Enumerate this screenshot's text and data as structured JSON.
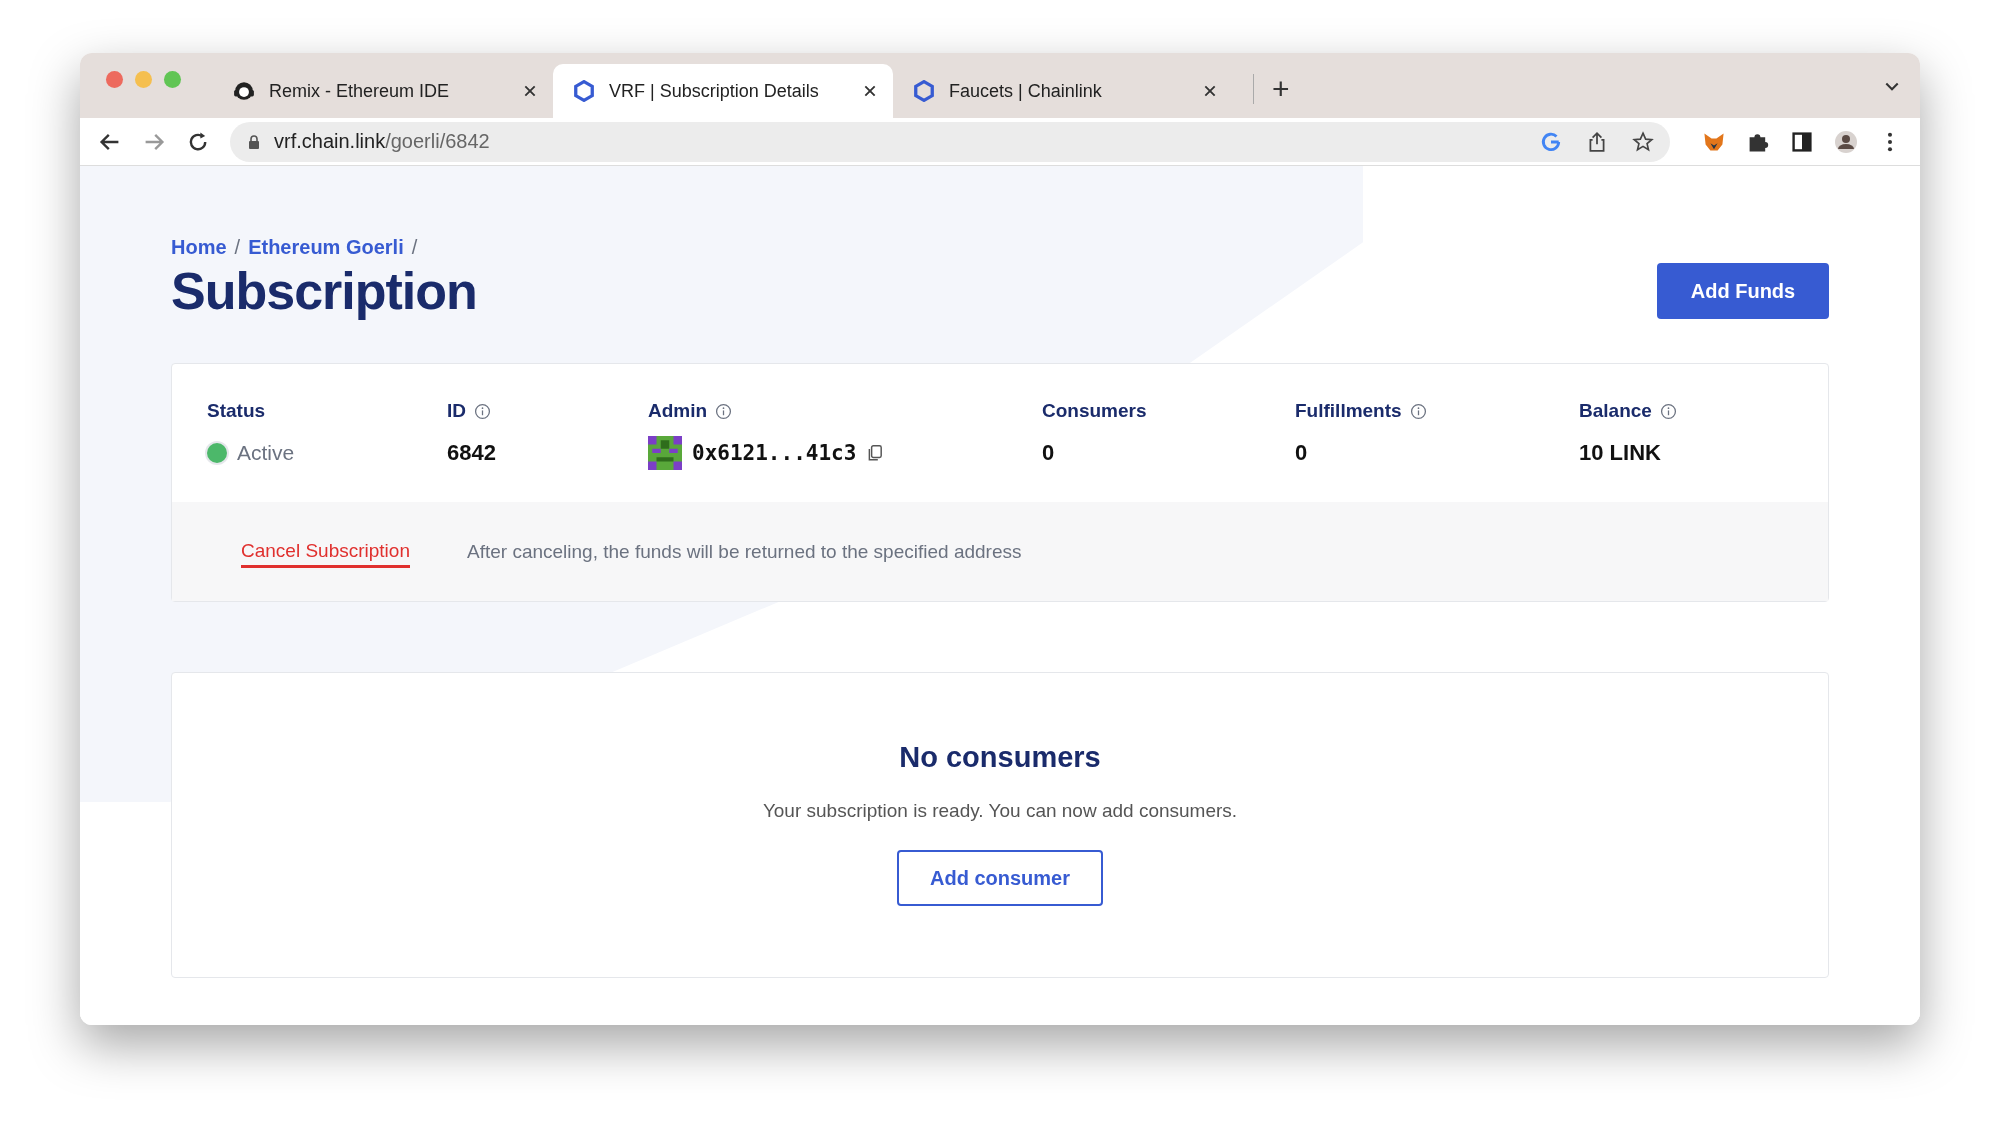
{
  "browser": {
    "tabs": [
      {
        "title": "Remix - Ethereum IDE",
        "selected": false
      },
      {
        "title": "VRF | Subscription Details",
        "selected": true
      },
      {
        "title": "Faucets | Chainlink",
        "selected": false
      }
    ],
    "new_tab": "+",
    "address": {
      "host": "vrf.chain.link",
      "path": "/goerli/6842"
    }
  },
  "breadcrumb": [
    "Home",
    "Ethereum Goerli"
  ],
  "breadcrumb_separator": "/",
  "title": "Subscription",
  "add_funds_button": "Add Funds",
  "stats": [
    {
      "label": "Status",
      "kind": "status",
      "value": "Active",
      "info": false,
      "color": "#4cb86a"
    },
    {
      "label": "ID",
      "kind": "text",
      "value": "6842",
      "info": true
    },
    {
      "label": "Admin",
      "kind": "address",
      "value": "0x6121...41c3",
      "info": true
    },
    {
      "label": "Consumers",
      "kind": "text",
      "value": "0",
      "info": false
    },
    {
      "label": "Fulfillments",
      "kind": "text",
      "value": "0",
      "info": true
    },
    {
      "label": "Balance",
      "kind": "text",
      "value": "10 LINK",
      "info": true
    }
  ],
  "cancel": {
    "link": "Cancel Subscription",
    "note": "After canceling, the funds will be returned to the specified address"
  },
  "consumers": {
    "title": "No consumers",
    "message": "Your subscription is ready. You can now add consumers.",
    "button": "Add consumer"
  }
}
